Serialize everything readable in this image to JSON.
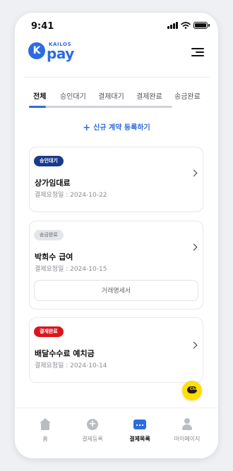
{
  "status_bar": {
    "time": "9:41"
  },
  "brand": {
    "logo_top": "KAILOS",
    "logo_main": "pay",
    "logo_mark": "K"
  },
  "tabs": [
    {
      "label": "전체",
      "active": true
    },
    {
      "label": "승인대기",
      "active": false
    },
    {
      "label": "결제대기",
      "active": false
    },
    {
      "label": "결제완료",
      "active": false
    },
    {
      "label": "송금완료",
      "active": false
    }
  ],
  "register_button": {
    "icon": "+",
    "label": "신규 계약 등록하기"
  },
  "contracts": [
    {
      "badge": "승인대기",
      "badge_color": "#1a3a8a",
      "title": "상가임대료",
      "date": "결제요청일 : 2024-10-22"
    },
    {
      "badge": "송금완료",
      "badge_color": "#e4e6e9",
      "title": "박희수 급여",
      "date": "결제요청일 : 2024-10-15",
      "action": "거래명세서"
    },
    {
      "badge": "결제완료",
      "badge_color": "#d9161d",
      "title": "배달수수료 예치금",
      "date": "결제요청일 : 2024-10-14"
    }
  ],
  "chat_fab": {
    "label": "Chat",
    "icon": "kakao-chat-icon"
  },
  "bottom_nav": [
    {
      "label": "홈",
      "icon": "home-icon",
      "active": false
    },
    {
      "label": "결제등록",
      "icon": "plus-circle-icon",
      "active": false
    },
    {
      "label": "결제목록",
      "icon": "list-icon",
      "active": true
    },
    {
      "label": "마이페이지",
      "icon": "person-icon",
      "active": false
    }
  ],
  "colors": {
    "accent": "#2c6ce0",
    "text": "#111111",
    "muted": "#8a8d92"
  }
}
